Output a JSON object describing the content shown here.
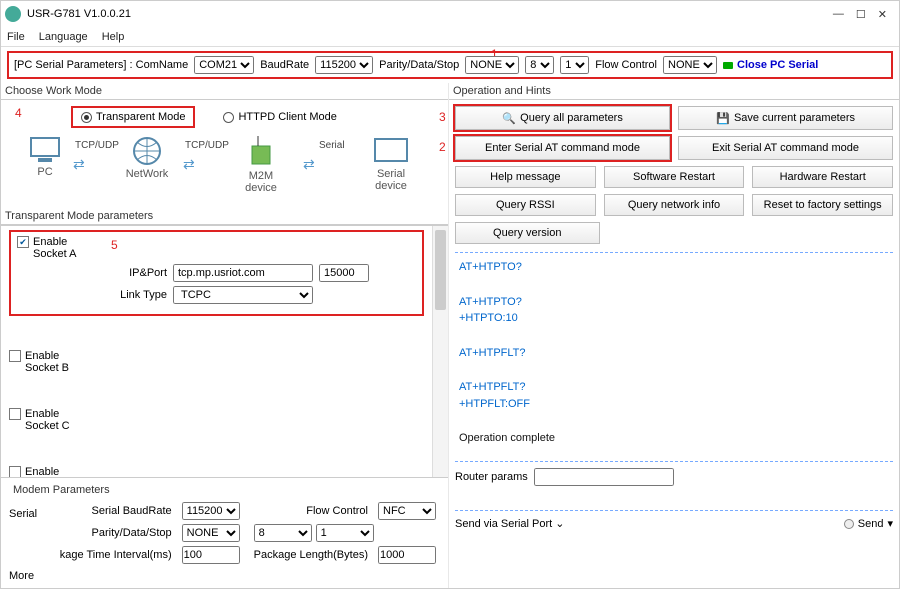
{
  "window": {
    "title": "USR-G781 V1.0.0.21",
    "min": "—",
    "max": "☐",
    "close": "✕"
  },
  "menu": {
    "file": "File",
    "language": "Language",
    "help": "Help"
  },
  "serialbar": {
    "label": "[PC Serial Parameters] : ComName",
    "comname": "COM21",
    "baudrate_lbl": "BaudRate",
    "baudrate": "115200",
    "pds_lbl": "Parity/Data/Stop",
    "parity": "NONE",
    "data": "8",
    "stop": "1",
    "flow_lbl": "Flow Control",
    "flow": "NONE",
    "close": "Close PC Serial"
  },
  "annot": {
    "n1": "1",
    "n2": "2",
    "n3": "3",
    "n4": "4",
    "n5": "5"
  },
  "workmode": {
    "hdr": "Choose Work Mode",
    "transparent": "Transparent Mode",
    "httpd": "HTTPD Client Mode"
  },
  "diagram": {
    "pc": "PC",
    "network": "NetWork",
    "m2m": "M2M device",
    "serialdev": "Serial device",
    "tcpudp": "TCP/UDP",
    "serial": "Serial"
  },
  "tm": {
    "hdr": "Transparent Mode parameters",
    "enableA": "Enable\nSocket A",
    "enableB": "Enable\nSocket B",
    "enableC": "Enable\nSocket C",
    "enableD": "Enable\nSocket D",
    "ipport_lbl": "IP&Port",
    "ip": "tcp.mp.usriot.com",
    "port": "15000",
    "linktype_lbl": "Link Type",
    "linktype": "TCPC"
  },
  "modem": {
    "hdr": "Modem Parameters",
    "serial_lbl": "Serial",
    "baud_lbl": "Serial BaudRate",
    "baud": "115200",
    "flow_lbl": "Flow Control",
    "flow": "NFC",
    "pds_lbl": "Parity/Data/Stop",
    "parity": "NONE",
    "data": "8",
    "stop": "1",
    "interval_lbl": "kage Time Interval(ms)",
    "interval": "100",
    "pkglen_lbl": "Package Length(Bytes)",
    "pkglen": "1000",
    "more": "More"
  },
  "ops": {
    "hdr": "Operation and Hints",
    "query_all": "Query all parameters",
    "save": "Save current parameters",
    "enter_at": "Enter Serial AT command mode",
    "exit_at": "Exit Serial AT command mode",
    "help": "Help message",
    "swrestart": "Software Restart",
    "hwrestart": "Hardware Restart",
    "rssi": "Query RSSI",
    "netinfo": "Query network info",
    "reset": "Reset to factory settings",
    "version": "Query version"
  },
  "log": {
    "l1": "AT+HTPTO?",
    "l2": "AT+HTPTO?",
    "l3": "+HTPTO:10",
    "l4": "AT+HTPFLT?",
    "l5": "AT+HTPFLT?",
    "l6": "+HTPFLT:OFF",
    "done": "Operation complete"
  },
  "router": {
    "lbl": "Router params",
    "val": ""
  },
  "send": {
    "lbl": "Send via Serial Port",
    "btn": "Send"
  }
}
